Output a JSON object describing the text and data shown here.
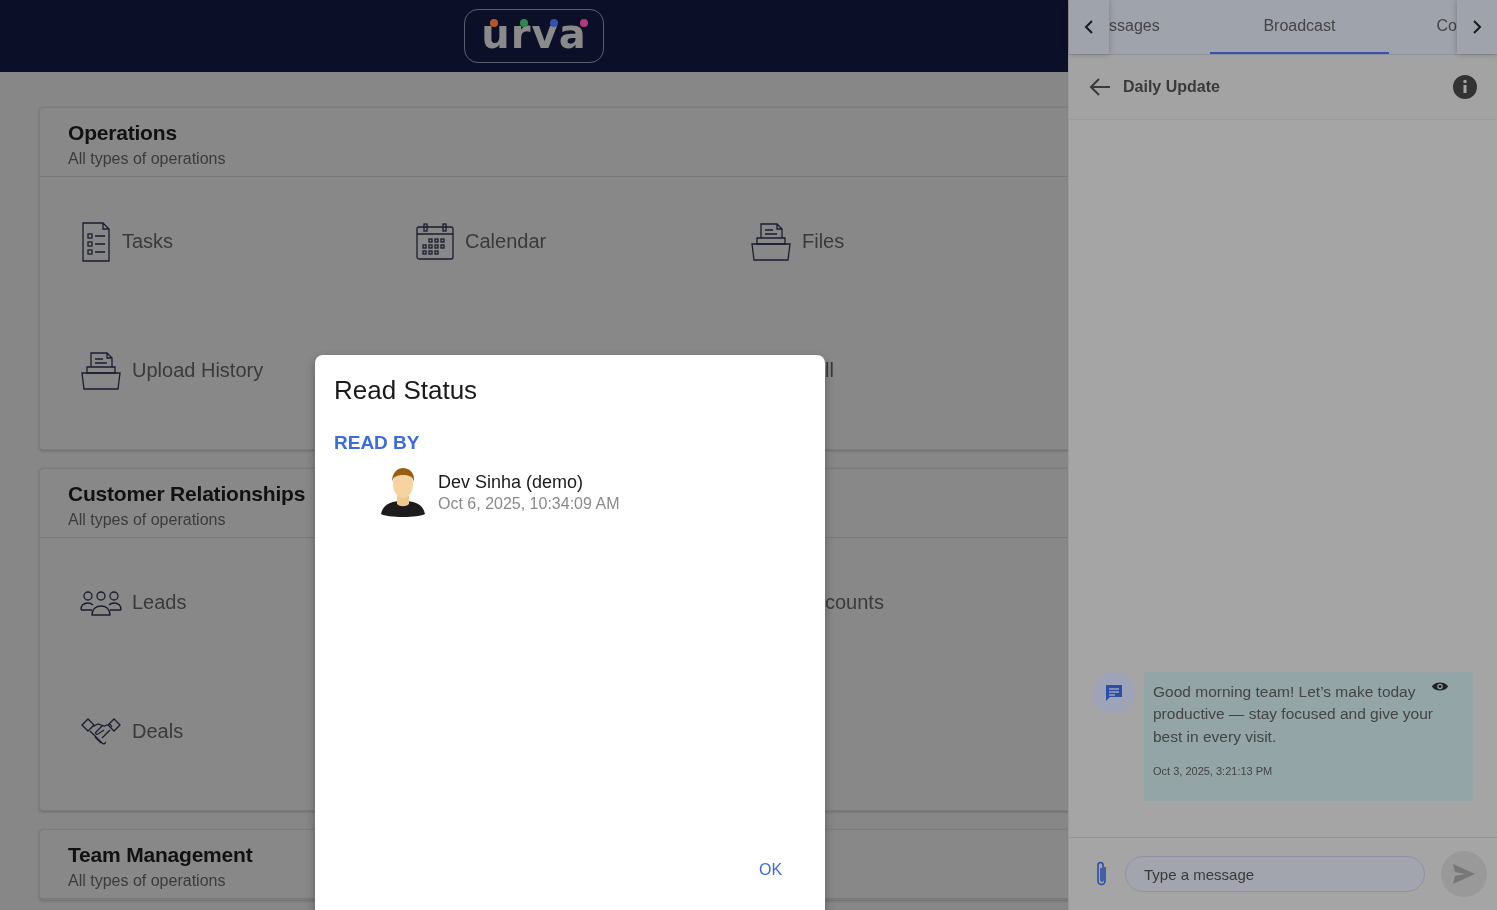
{
  "header": {
    "logo": "urva"
  },
  "sections": [
    {
      "title": "Operations",
      "subtitle": "All types of operations",
      "items": [
        {
          "label": "Tasks",
          "kind": "full"
        },
        {
          "label": "Calendar",
          "kind": "full"
        },
        {
          "label": "Files",
          "kind": "full"
        },
        {
          "label": "Upload History",
          "kind": "full"
        },
        {
          "label": "ll",
          "kind": "partial"
        }
      ]
    },
    {
      "title": "Customer Relationships",
      "subtitle": "All types of operations",
      "items": [
        {
          "label": "Leads",
          "kind": "full"
        },
        {
          "label": "counts",
          "kind": "partial"
        },
        {
          "label": "Deals",
          "kind": "full"
        }
      ]
    },
    {
      "title": "Team Management",
      "subtitle": "All types of operations"
    }
  ],
  "chat_panel": {
    "tabs": [
      {
        "label": "ssages",
        "selected": false
      },
      {
        "label": "Broadcast",
        "selected": true
      },
      {
        "label": "Co",
        "selected": false
      }
    ],
    "conversation_title": "Daily Update",
    "messages": [
      {
        "text": "Good morning team! Let’s make today productive — stay focused and give your best in every visit.",
        "time": "Oct 3, 2025, 3:21:13 PM"
      }
    ],
    "composer": {
      "placeholder": "Type a message"
    }
  },
  "dialog": {
    "title": "Read Status",
    "section_label": "READ BY",
    "readers": [
      {
        "name": "Dev Sinha (demo)",
        "time": "Oct 6, 2025, 10:34:09 AM"
      }
    ],
    "button": "OK"
  }
}
